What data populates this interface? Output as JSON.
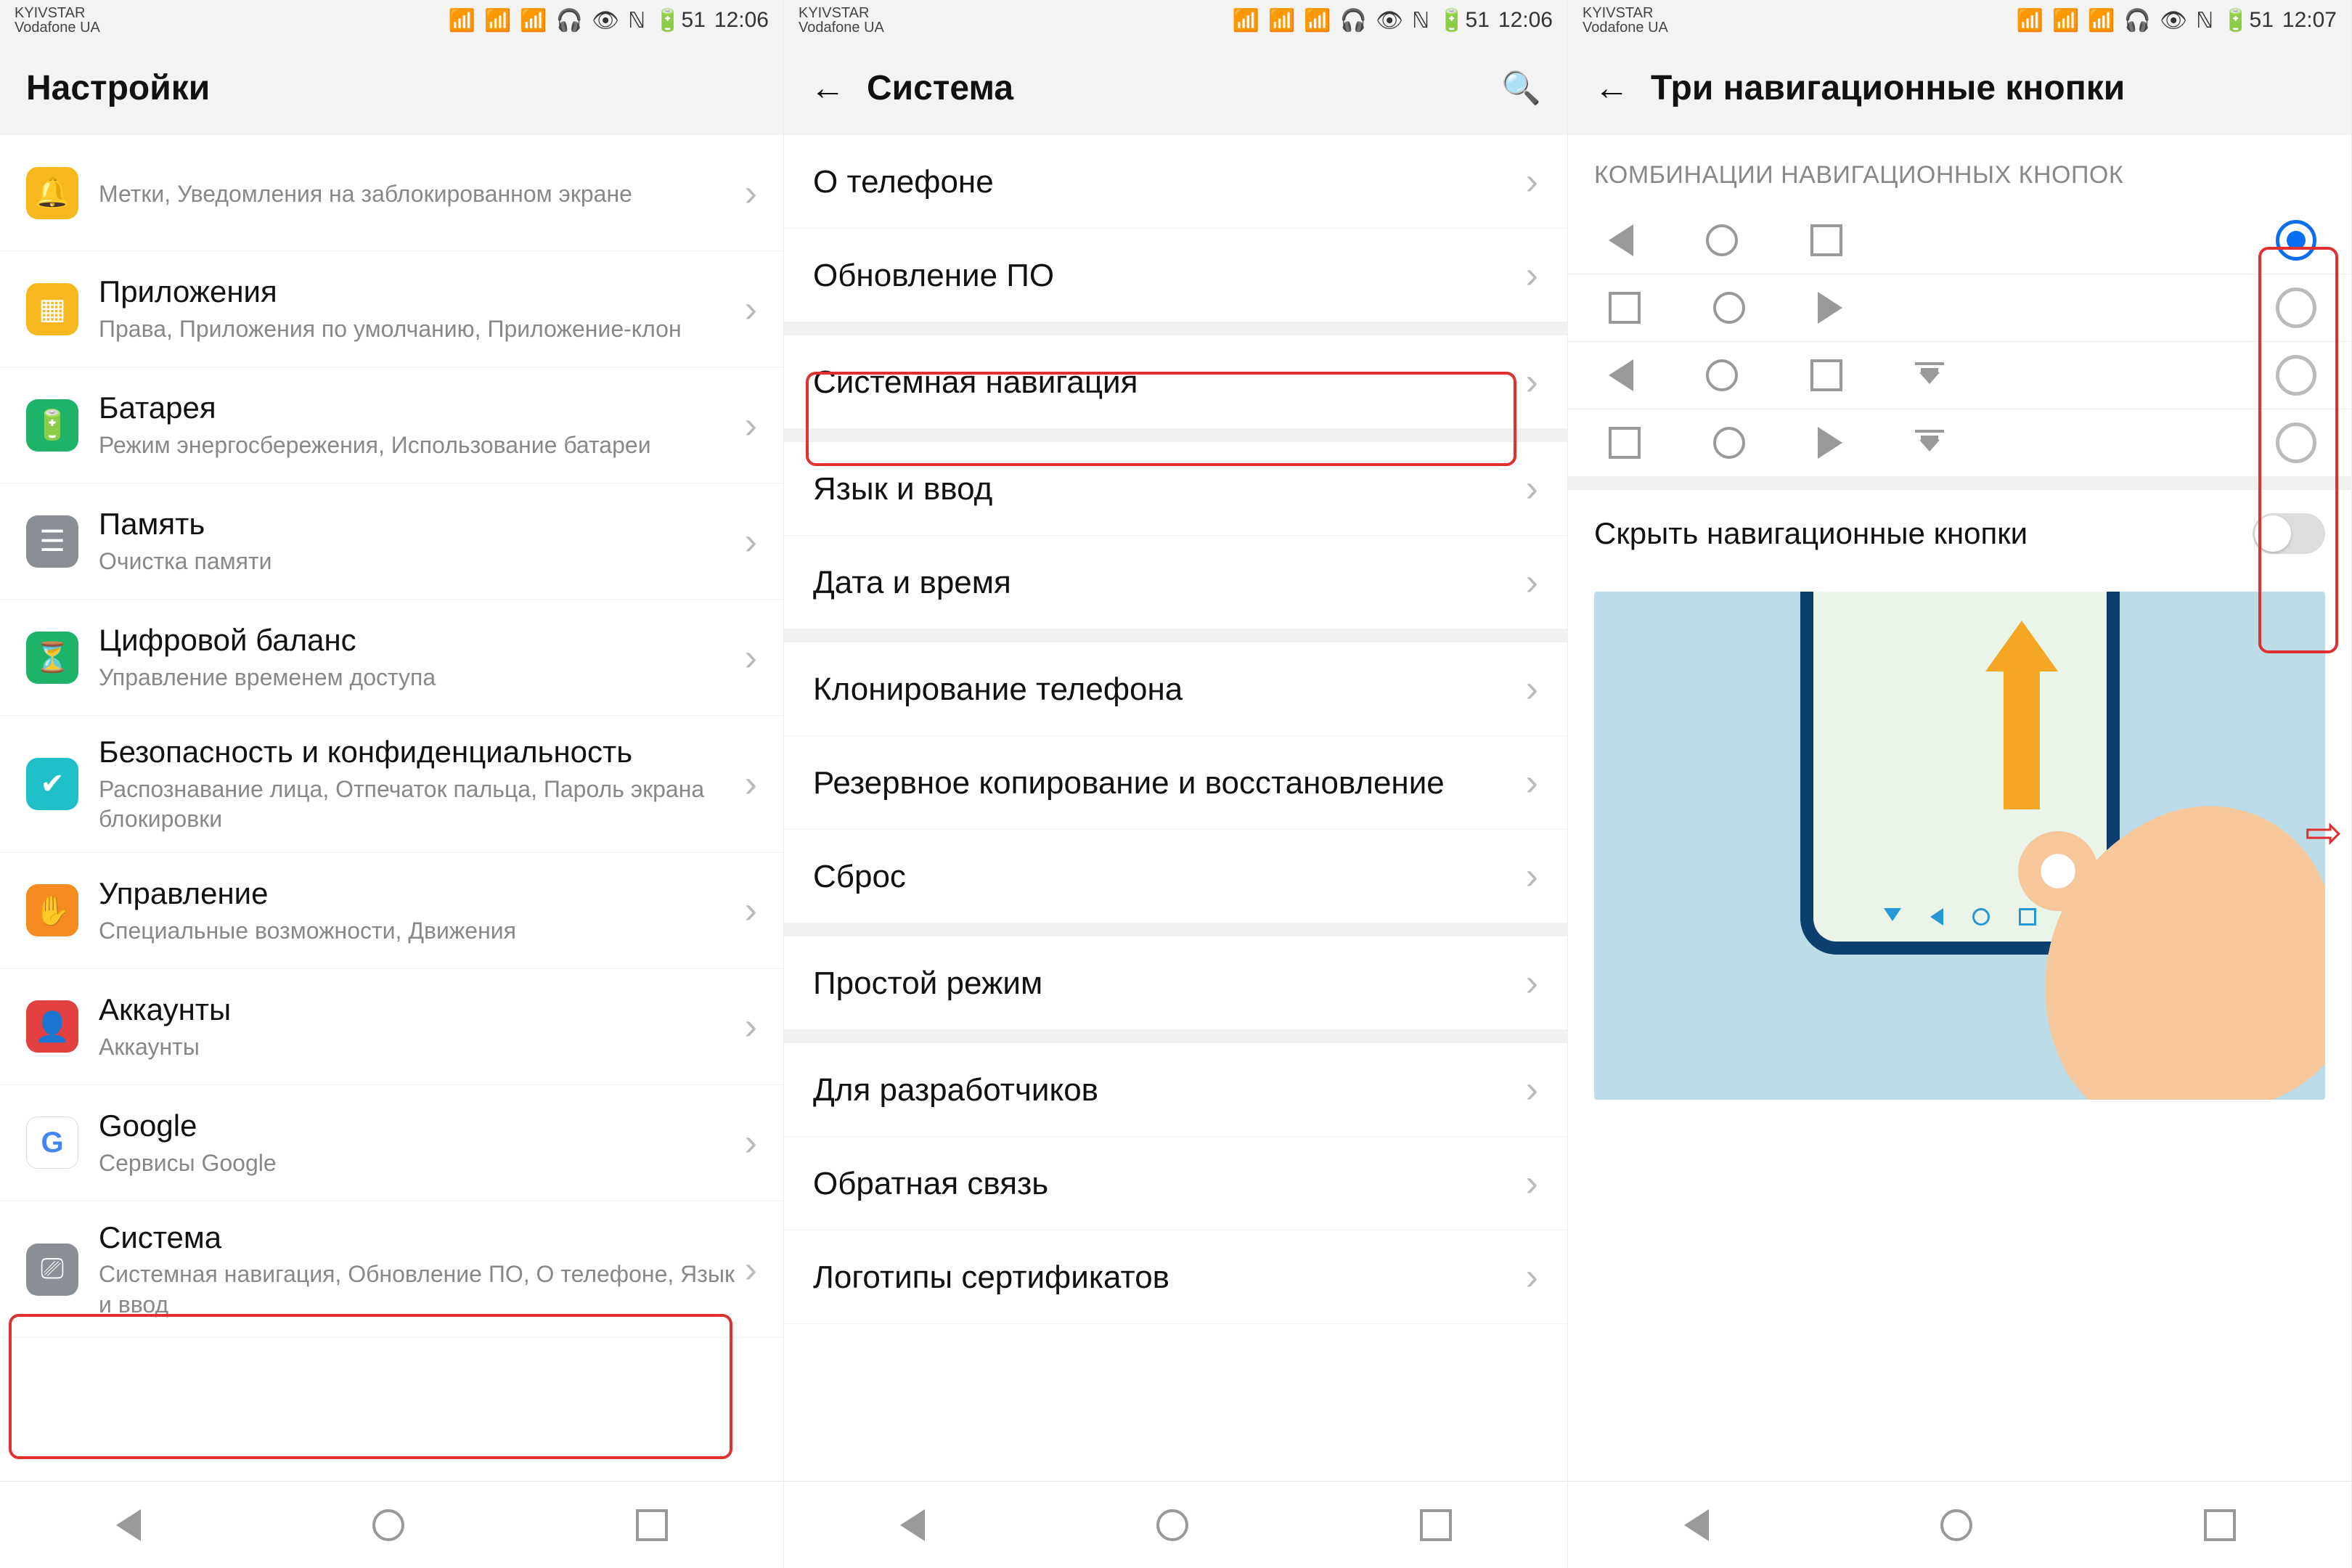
{
  "status": {
    "carrier1": "KYIVSTAR",
    "carrier2": "Vodafone UA",
    "battery": "51",
    "time_a": "12:06",
    "time_b": "12:07"
  },
  "screen1": {
    "title": "Настройки",
    "items": [
      {
        "t": "",
        "s": "Метки, Уведомления на заблокированном экране",
        "color": "#f6b81e",
        "icon": "🔔"
      },
      {
        "t": "Приложения",
        "s": "Права, Приложения по умолчанию, Приложение-клон",
        "color": "#f6b81e",
        "icon": "▦"
      },
      {
        "t": "Батарея",
        "s": "Режим энергосбережения, Использование батареи",
        "color": "#1fb36a",
        "icon": "🔋"
      },
      {
        "t": "Память",
        "s": "Очистка памяти",
        "color": "#8a8f95",
        "icon": "☰"
      },
      {
        "t": "Цифровой баланс",
        "s": "Управление временем доступа",
        "color": "#1fb36a",
        "icon": "⏳"
      },
      {
        "t": "Безопасность и конфиденциальность",
        "s": "Распознавание лица, Отпечаток пальца, Пароль экрана блокировки",
        "color": "#1fc0c7",
        "icon": "✔"
      },
      {
        "t": "Управление",
        "s": "Специальные возможности, Движения",
        "color": "#f68c1f",
        "icon": "✋"
      },
      {
        "t": "Аккаунты",
        "s": "Аккаунты",
        "color": "#e34141",
        "icon": "👤"
      },
      {
        "t": "Google",
        "s": "Сервисы Google",
        "color": "#fff",
        "icon": "G"
      },
      {
        "t": "Система",
        "s": "Системная навигация, Обновление ПО, О телефоне, Язык и ввод",
        "color": "#8a8f95",
        "icon": "⎚"
      }
    ]
  },
  "screen2": {
    "title": "Система",
    "groups": [
      [
        "О телефоне",
        "Обновление ПО"
      ],
      [
        "Системная навигация"
      ],
      [
        "Язык и ввод",
        "Дата и время"
      ],
      [
        "Клонирование телефона",
        "Резервное копирование и восстановление",
        "Сброс"
      ],
      [
        "Простой режим"
      ],
      [
        "Для разработчиков",
        "Обратная связь",
        "Логотипы сертификатов"
      ]
    ]
  },
  "screen3": {
    "title": "Три навигационные кнопки",
    "section": "КОМБИНАЦИИ НАВИГАЦИОННЫХ КНОПОК",
    "hide_label": "Скрыть навигационные кнопки",
    "options": [
      {
        "icons": [
          "tri",
          "circ",
          "sq"
        ],
        "selected": true
      },
      {
        "icons": [
          "sq",
          "circ",
          "tri"
        ],
        "selected": false
      },
      {
        "icons": [
          "tri",
          "circ",
          "sq",
          "notif"
        ],
        "selected": false
      },
      {
        "icons": [
          "sq",
          "circ",
          "tri",
          "notif"
        ],
        "selected": false
      }
    ]
  }
}
